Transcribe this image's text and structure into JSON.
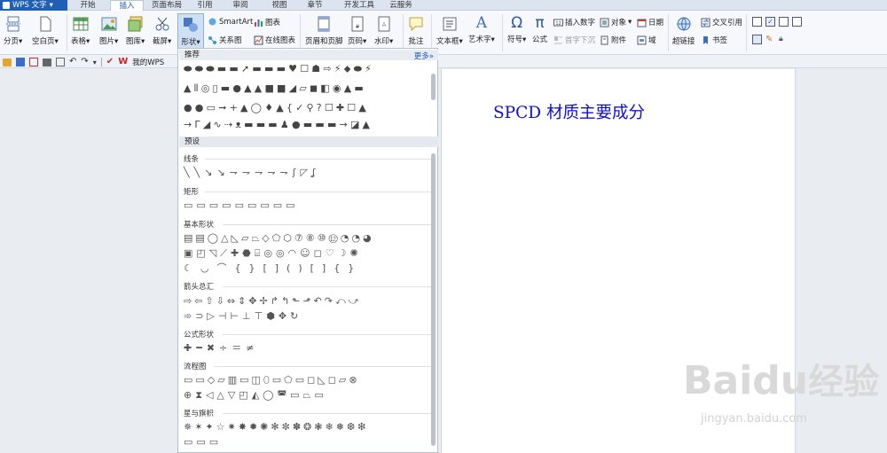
{
  "app": {
    "name": "WPS 文字",
    "dropdown": "▾"
  },
  "menu": {
    "tabs": [
      "开始",
      "插入",
      "页面布局",
      "引用",
      "审阅",
      "视图",
      "章节",
      "开发工具",
      "云服务"
    ],
    "active": "插入"
  },
  "ribbon": {
    "page_break": "分页",
    "blank_page": "空白页",
    "table": "表格",
    "picture": "图片",
    "gallery": "图库",
    "screenshot": "截屏",
    "shapes": "形状",
    "smartart": "SmartArt",
    "chart": "图表",
    "relation": "关系图",
    "online_chart": "在线图表",
    "header_footer": "页眉和页脚",
    "page_number": "页码",
    "watermark": "水印",
    "comment": "批注",
    "textbox": "文本框",
    "wordart": "艺术字",
    "symbol": "符号",
    "formula": "公式",
    "insert_number": "插入数字",
    "object": "对象",
    "date": "日期",
    "drop_cap": "首字下沉",
    "attachment": "附件",
    "field": "域",
    "hyperlink": "超链接",
    "cross_ref": "交叉引用",
    "bookmark": "书签",
    "arrow": "▾",
    "symbol_glyph": "Ω",
    "pi_glyph": "π",
    "wordart_glyph": "A"
  },
  "quickbar": {
    "my_wps": "我的WPS"
  },
  "shapes_panel": {
    "recommended": "推荐",
    "more": "更多»",
    "preset": "预设",
    "sections": [
      "线条",
      "矩形",
      "基本形状",
      "箭头总汇",
      "公式形状",
      "流程图",
      "星与旗帜"
    ],
    "recommended_rows": [
      "⬬⬬⬬▬▬➚▬▬▬♥☐☗⇨⚡⬥⬬⚡",
      "▲⦀◎▯▬●▲▲■■◢▱◼◧◉▲▬",
      "●●▭➞+▲◯♦▲{✓⚲?☐✚☐▲",
      "→Γ◢∿⇢ᴥ▬▬▬♟●▬▬▬→◪▲"
    ],
    "shape_rows": {
      "lines": "╲╲↘↘⇁⇁⇁⇁⇁ʃ◸ʆ",
      "rectangles": "▭▭▭▭▭▭▭▭▭",
      "basic": [
        "▤▤◯△◺▱⏢◇⬠⬡⑦⑧⑩⑫◔◔◕",
        "▣◰◹⟋✚⬣⌸◎◎◠☺◻♡☽✺",
        "☾◡⌒{}[]()[]{}",
        ""
      ],
      "arrows": [
        "⇨⇦⇧⇩⇔⇕✥✢↱↰⬑⬏↶↷⤺⤻",
        "➾⊃▷⊣⊢⊥⊤⬢✥↻"
      ],
      "formula": "✚━✖÷＝≠",
      "flowchart": [
        "▭▭◇▱▥▭◫⬯▭⬠▭◻◺◻▱⊗",
        "⊕⧗◁△▽◰◭◯◚▭⏢▭"
      ],
      "stars": [
        "✵✶✦☆✷✸✹✺✻✼✽❂❃❄❅❆❇",
        "▭▭▭"
      ]
    }
  },
  "document": {
    "title": "SPCD 材质主要成分"
  },
  "watermark": {
    "brand": "Baidu",
    "cn": "经验",
    "url": "jingyan.baidu.com"
  },
  "colors": {
    "accent": "#1f5fb6",
    "doc_title": "#1010c8",
    "watermark": "#d9d9d9"
  }
}
